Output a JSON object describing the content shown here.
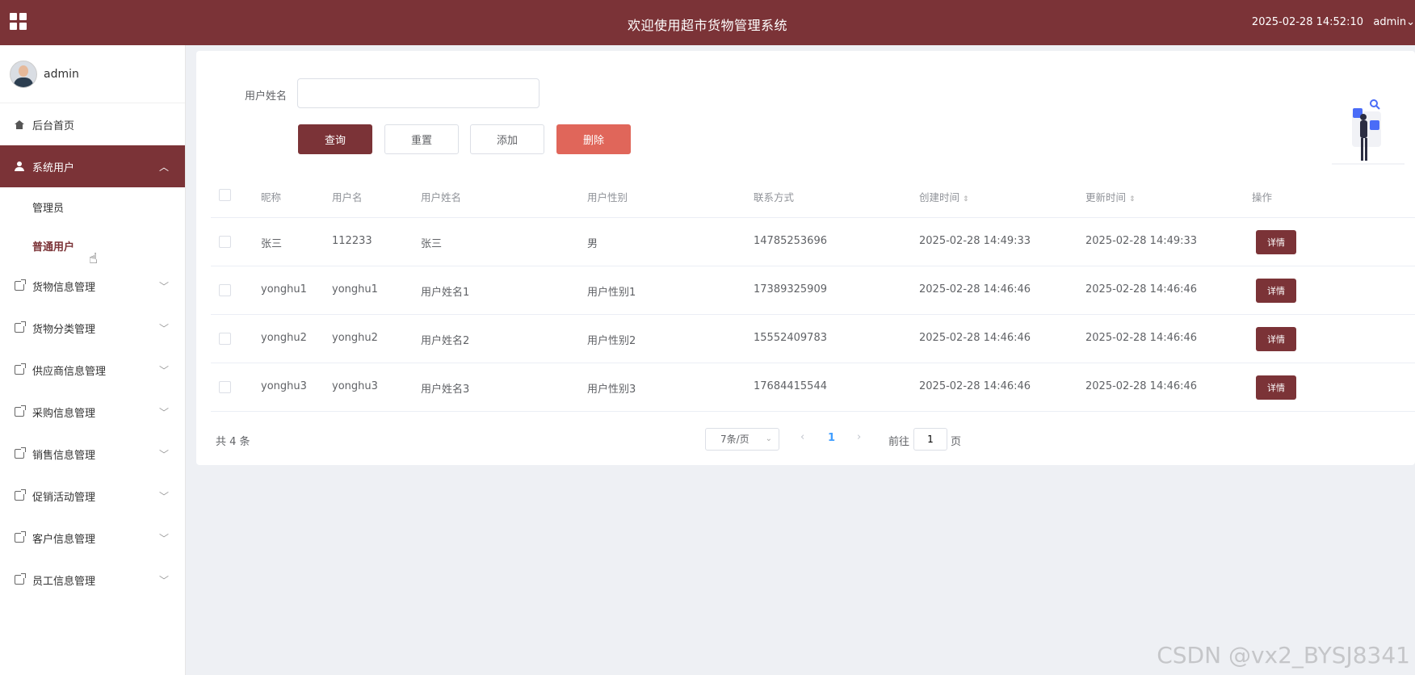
{
  "header": {
    "title": "欢迎使用超市货物管理系统",
    "datetime": "2025-02-28 14:52:10",
    "user_menu": "admin"
  },
  "sidebar": {
    "profile_name": "admin",
    "items": [
      {
        "label": "后台首页",
        "icon": "home-icon"
      },
      {
        "label": "系统用户",
        "icon": "user-icon",
        "chevron": "up"
      },
      {
        "label": "货物信息管理",
        "icon": "doc-icon",
        "chevron": "down"
      },
      {
        "label": "货物分类管理",
        "icon": "doc-icon",
        "chevron": "down"
      },
      {
        "label": "供应商信息管理",
        "icon": "doc-icon",
        "chevron": "down"
      },
      {
        "label": "采购信息管理",
        "icon": "doc-icon",
        "chevron": "down"
      },
      {
        "label": "销售信息管理",
        "icon": "doc-icon",
        "chevron": "down"
      },
      {
        "label": "促销活动管理",
        "icon": "doc-icon",
        "chevron": "down"
      },
      {
        "label": "客户信息管理",
        "icon": "doc-icon",
        "chevron": "down"
      },
      {
        "label": "员工信息管理",
        "icon": "doc-icon",
        "chevron": "down"
      }
    ],
    "sub_items": [
      "管理员",
      "普通用户"
    ]
  },
  "search": {
    "label": "用户姓名",
    "value": "",
    "placeholder": ""
  },
  "buttons": {
    "query": "查询",
    "reset": "重置",
    "add": "添加",
    "delete": "删除"
  },
  "table": {
    "headers": [
      "昵称",
      "用户名",
      "用户姓名",
      "用户性别",
      "联系方式",
      "创建时间",
      "更新时间",
      "操作"
    ],
    "rows": [
      [
        "张三",
        "112233",
        "张三",
        "男",
        "14785253696",
        "2025-02-28 14:49:33",
        "2025-02-28 14:49:33",
        "详情"
      ],
      [
        "yonghu1",
        "yonghu1",
        "用户姓名1",
        "用户性别1",
        "17389325909",
        "2025-02-28 14:46:46",
        "2025-02-28 14:46:46",
        "详情"
      ],
      [
        "yonghu2",
        "yonghu2",
        "用户姓名2",
        "用户性别2",
        "15552409783",
        "2025-02-28 14:46:46",
        "2025-02-28 14:46:46",
        "详情"
      ],
      [
        "yonghu3",
        "yonghu3",
        "用户姓名3",
        "用户性别3",
        "17684415544",
        "2025-02-28 14:46:46",
        "2025-02-28 14:46:46",
        "详情"
      ]
    ]
  },
  "pagination": {
    "total": "共 4 条",
    "page_size": "7条/页",
    "current_page": "1",
    "goto_label": "前往",
    "goto_value": "1",
    "goto_suffix": "页"
  },
  "watermark": "CSDN @vx2_BYSJ8341",
  "colors": {
    "primary": "#7b3337",
    "danger": "#e0665a",
    "link": "#409eff"
  }
}
